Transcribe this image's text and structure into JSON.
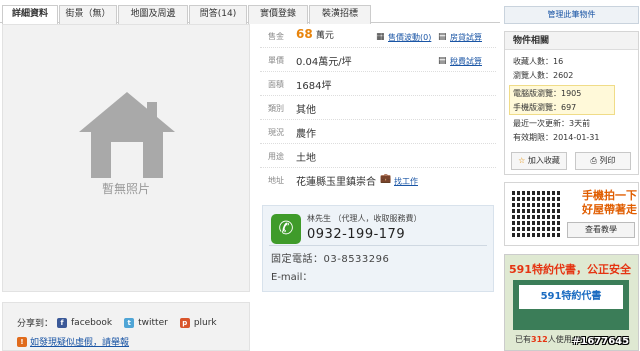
{
  "tabs": [
    "詳細資料",
    "街景（無）",
    "地圖及周邊",
    "問答(14)",
    "實價登錄",
    "裝潢招標"
  ],
  "photo": {
    "placeholder": "暫無照片"
  },
  "share": {
    "label": "分享到：",
    "facebook": "facebook",
    "twitter": "twitter",
    "plurk": "plurk",
    "report": "如發現疑似虛假，請舉報"
  },
  "info": {
    "price_label": "售金",
    "price_value": "68",
    "price_unit": "萬元",
    "price_link1": "售價波動(0)",
    "price_link2": "房貸試算",
    "unit_label": "單價",
    "unit_value": "0.04萬元/坪",
    "unit_link": "稅費試算",
    "area_label": "面積",
    "area_value": "1684坪",
    "type_label": "類別",
    "type_value": "其他",
    "use_label": "現況",
    "use_value": "農作",
    "purpose_label": "用途",
    "purpose_value": "土地",
    "addr_label": "地址",
    "addr_value": "花蓮縣玉里鎮崇合",
    "addr_link": "找工作"
  },
  "agent": {
    "name": "林先生 （代理人，收取服務費）",
    "phone": "0932-199-179",
    "tel": "固定電話：03-8533296",
    "email": "E-mail："
  },
  "side": {
    "manage": "管理此筆物件",
    "stats_title": "物件相關",
    "favorites": "收藏人數：16",
    "views": "瀏覽人數：2602",
    "pc_views": "電腦版瀏覽：1905",
    "mobile_views": "手機版瀏覽：697",
    "updated": "最近一次更新：3天前",
    "expires": "有效期限：2014-01-31",
    "add_fav": "加入收藏",
    "print": "列印",
    "mobile_line1": "手機拍一下",
    "mobile_line2": "好屋帶著走",
    "tutorial": "查看教學"
  },
  "ad": {
    "title": "591特約代書，公正安全",
    "sign": "591特約代書",
    "foot_pre": "已有",
    "foot_num": "312",
    "foot_post": "人使用，"
  },
  "watermark": "#1677645"
}
